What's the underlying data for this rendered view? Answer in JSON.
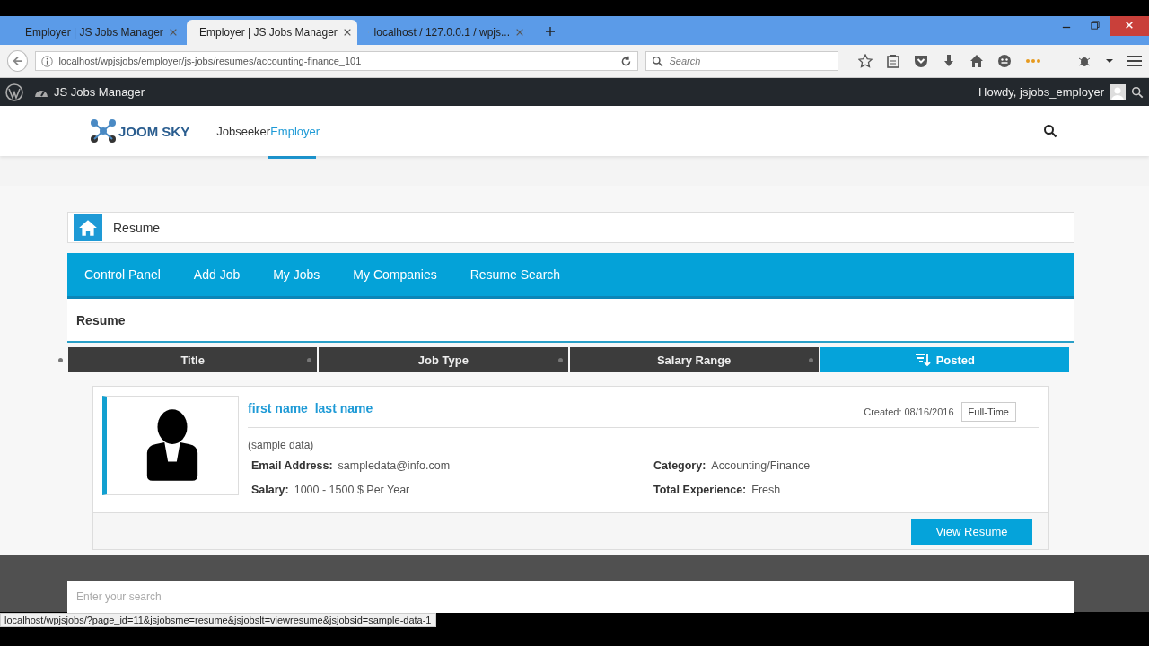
{
  "browser": {
    "tabs": [
      {
        "title": "Employer | JS Jobs Manager",
        "kind": "loading",
        "selected": false
      },
      {
        "title": "Employer | JS Jobs Manager",
        "kind": "site",
        "selected": true
      },
      {
        "title": "localhost / 127.0.0.1 / wpjs...",
        "kind": "database",
        "selected": false
      }
    ],
    "address": "localhost/wpjsjobs/employer/js-jobs/resumes/accounting-finance_101",
    "search_placeholder": "Search",
    "status_url": "localhost/wpjsjobs/?page_id=11&jsjobsme=resume&jsjobslt=viewresume&jsjobsid=sample-data-1"
  },
  "admin_bar": {
    "site": "JS Jobs Manager",
    "greeting": "Howdy, jsjobs_employer"
  },
  "header": {
    "logo": "JOOM SKY",
    "roles": [
      {
        "label": "Jobseeker",
        "selected": false
      },
      {
        "label": "Employer",
        "selected": true
      }
    ]
  },
  "breadcrumb": "Resume",
  "nav": [
    "Control Panel",
    "Add Job",
    "My Jobs",
    "My Companies",
    "Resume Search"
  ],
  "section_title": "Resume",
  "sort_columns": [
    {
      "label": "Title",
      "selected": false
    },
    {
      "label": "Job Type",
      "selected": false
    },
    {
      "label": "Salary Range",
      "selected": false
    },
    {
      "label": "Posted",
      "selected": true
    }
  ],
  "resumes": [
    {
      "name": "first name  last name",
      "note": "(sample data)",
      "created": "Created: 08/16/2016",
      "job_type": "Full-Time",
      "fields": [
        {
          "label": "Email Address:",
          "value": "sampledata@info.com"
        },
        {
          "label": "Category:",
          "value": "Accounting/Finance"
        },
        {
          "label": "Salary:",
          "value": "1000 - 1500 $ Per Year"
        },
        {
          "label": "Total Experience:",
          "value": "Fresh"
        }
      ],
      "action": "View Resume"
    }
  ],
  "footer": {
    "search_placeholder": "Enter your search"
  }
}
